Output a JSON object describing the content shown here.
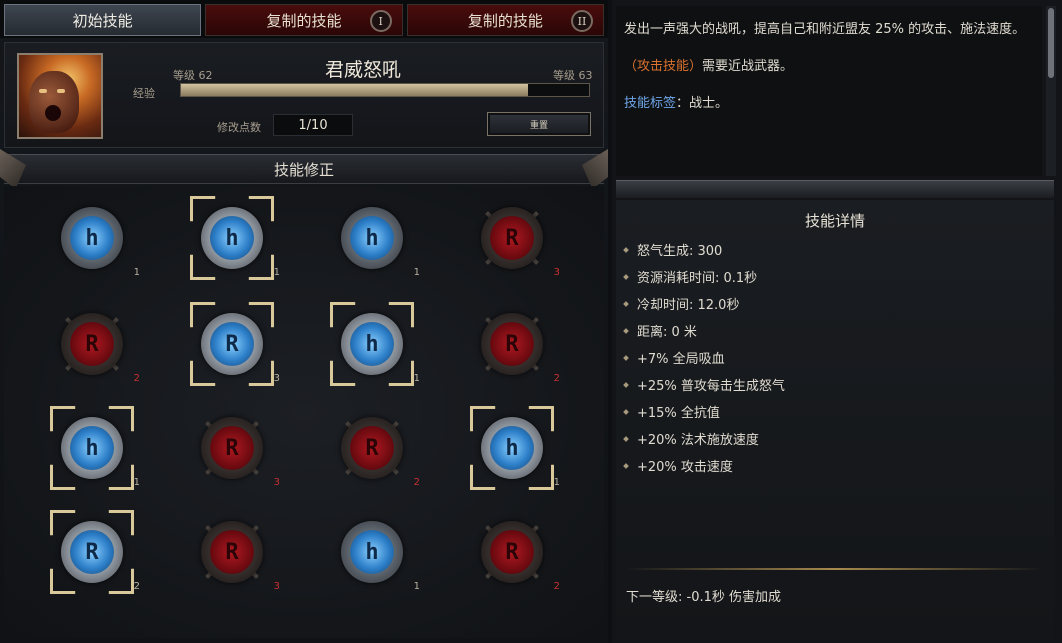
{
  "tabs": [
    {
      "label": "初始技能",
      "badge": ""
    },
    {
      "label": "复制的技能",
      "badge": "I"
    },
    {
      "label": "复制的技能",
      "badge": "II"
    }
  ],
  "skill": {
    "name": "君威怒吼",
    "level_left": "等级 62",
    "level_right": "等级 63",
    "xp_label": "经验",
    "xp_progress": 0.85,
    "points_label": "修改点数",
    "points_value": "1/10",
    "reset_label": "重置"
  },
  "modifiers": {
    "title": "技能修正",
    "runes": [
      {
        "color": "blue",
        "glyph": "h",
        "selected": false,
        "level": "1"
      },
      {
        "color": "blue",
        "glyph": "h",
        "selected": true,
        "level": "1"
      },
      {
        "color": "blue",
        "glyph": "h",
        "selected": false,
        "level": "1"
      },
      {
        "color": "red",
        "glyph": "R",
        "selected": false,
        "level": "3"
      },
      {
        "color": "red",
        "glyph": "R",
        "selected": false,
        "level": "2"
      },
      {
        "color": "blue",
        "glyph": "R",
        "selected": true,
        "level": "3"
      },
      {
        "color": "blue",
        "glyph": "h",
        "selected": true,
        "level": "1"
      },
      {
        "color": "red",
        "glyph": "R",
        "selected": false,
        "level": "2"
      },
      {
        "color": "blue",
        "glyph": "h",
        "selected": true,
        "level": "1"
      },
      {
        "color": "red",
        "glyph": "R",
        "selected": false,
        "level": "3"
      },
      {
        "color": "red",
        "glyph": "R",
        "selected": false,
        "level": "2"
      },
      {
        "color": "blue",
        "glyph": "h",
        "selected": true,
        "level": "1"
      },
      {
        "color": "blue",
        "glyph": "R",
        "selected": true,
        "level": "2"
      },
      {
        "color": "red",
        "glyph": "R",
        "selected": false,
        "level": "3"
      },
      {
        "color": "blue",
        "glyph": "h",
        "selected": false,
        "level": "1"
      },
      {
        "color": "red",
        "glyph": "R",
        "selected": false,
        "level": "2"
      }
    ]
  },
  "description": {
    "main": "发出一声强大的战吼，提高自己和附近盟友 25% 的攻击、施法速度。",
    "attack_tag": "（攻击技能）",
    "attack_req": "需要近战武器。",
    "tags_label": "技能标签",
    "tags_value": "：战士。"
  },
  "details": {
    "title": "技能详情",
    "items": [
      "怒气生成: 300",
      "资源消耗时间: 0.1秒",
      "冷却时间: 12.0秒",
      "距离: 0 米",
      "+7% 全局吸血",
      "+25% 普攻每击生成怒气",
      "+15% 全抗值",
      "+20% 法术施放速度",
      "+20% 攻击速度"
    ],
    "next_level": "下一等级: -0.1秒 伤害加成"
  },
  "colors": {
    "accent_orange": "#d9722e",
    "tag_blue": "#6fa6e8",
    "rune_red_level": "#c83030",
    "gold": "#d8c89a"
  }
}
